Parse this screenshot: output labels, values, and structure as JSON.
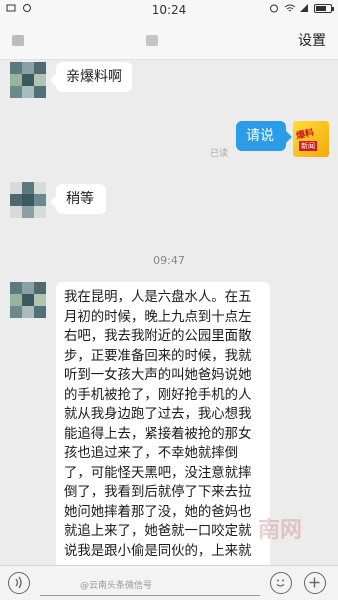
{
  "status_bar": {
    "time": "10:24"
  },
  "title_bar": {
    "settings_label": "设置"
  },
  "messages": {
    "msg1": "亲爆料啊",
    "msg2": "请说",
    "msg2_read": "已读",
    "msg3": "稍等",
    "timestamp": "09:47",
    "msg4": "我在昆明，人是六盘水人。在五月初的时候，晚上九点到十点左右吧，我去我附近的公园里面散步，正要准备回来的时候，我就听到一女孩大声的叫她爸妈说她的手机被抢了，刚好抢手机的人就从我身边跑了过去，我心想我能追得上去，紧接着被抢的那女孩也追过来了，不幸她就摔倒了，可能怪天黑吧，没注意就摔倒了，我看到后就停了下来去拉她问她摔着那了没，她的爸妈也就追上来了，她爸就一口咬定就说我是跟小偷是同伙的，上来就"
  },
  "self_avatar": {
    "text1": "爆料",
    "text2": "新闻"
  },
  "input_bar": {
    "watermark": "@云南头条微信号"
  },
  "watermark_overlay": "南网",
  "colors": {
    "accent": "#2a9ce8",
    "background": "#ececec",
    "bubble": "#ffffff"
  }
}
